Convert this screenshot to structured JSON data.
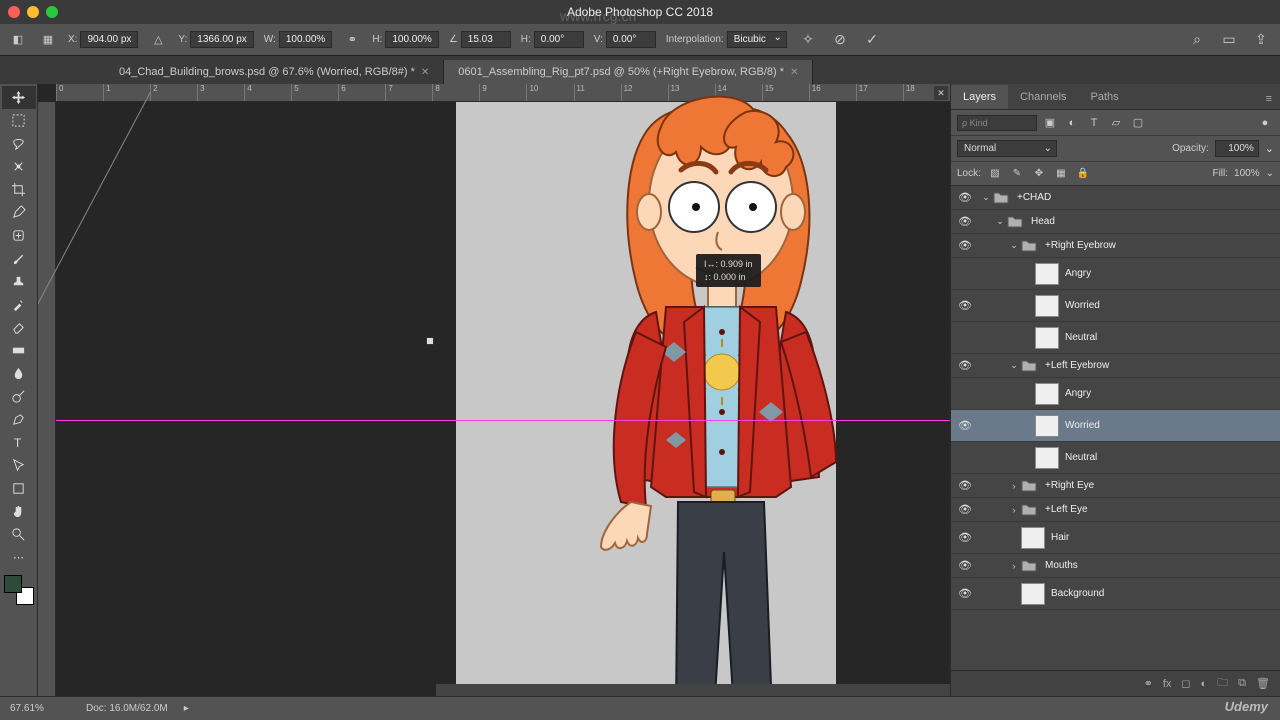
{
  "app": {
    "title": "Adobe Photoshop CC 2018"
  },
  "options": {
    "x_label": "X:",
    "x_value": "904.00 px",
    "y_label": "Y:",
    "y_value": "1366.00 px",
    "w_label": "W:",
    "w_value": "100.00%",
    "h_label": "H:",
    "h_value": "100.00%",
    "angle_label": "∠",
    "angle_value": "15.03",
    "hskew_label": "H:",
    "hskew_value": "0.00°",
    "vskew_label": "V:",
    "vskew_value": "0.00°",
    "interp_label": "Interpolation:",
    "interp_value": "Bicubic"
  },
  "tabs": [
    {
      "label": "04_Chad_Building_brows.psd @ 67.6% (Worried, RGB/8#) *",
      "active": false
    },
    {
      "label": "0601_Assembling_Rig_pt7.psd @ 50% (+Right Eyebrow, RGB/8) *",
      "active": true
    }
  ],
  "ruler_marks": [
    "0",
    "1",
    "2",
    "3",
    "4",
    "5",
    "6",
    "7",
    "8",
    "9",
    "10",
    "11",
    "12",
    "13",
    "14",
    "15",
    "16",
    "17",
    "18"
  ],
  "measure": {
    "line1": "I↔: 0.909 in",
    "line2": "↕: 0.000 in"
  },
  "panels": {
    "tabs": {
      "layers": "Layers",
      "channels": "Channels",
      "paths": "Paths"
    },
    "filter_placeholder": "ρ Kind",
    "blend_mode": "Normal",
    "opacity_label": "Opacity:",
    "opacity_value": "100%",
    "lock_label": "Lock:",
    "fill_label": "Fill:",
    "fill_value": "100%"
  },
  "layers": [
    {
      "name": "+CHAD",
      "type": "group",
      "indent": 0,
      "vis": true,
      "open": true
    },
    {
      "name": "Head",
      "type": "group",
      "indent": 1,
      "vis": true,
      "open": true
    },
    {
      "name": "+Right Eyebrow",
      "type": "group",
      "indent": 2,
      "vis": true,
      "open": true
    },
    {
      "name": "Angry",
      "type": "layer",
      "indent": 3,
      "vis": false
    },
    {
      "name": "Worried",
      "type": "layer",
      "indent": 3,
      "vis": true
    },
    {
      "name": "Neutral",
      "type": "layer",
      "indent": 3,
      "vis": false
    },
    {
      "name": "+Left Eyebrow",
      "type": "group",
      "indent": 2,
      "vis": true,
      "open": true
    },
    {
      "name": "Angry",
      "type": "layer",
      "indent": 3,
      "vis": false
    },
    {
      "name": "Worried",
      "type": "layer",
      "indent": 3,
      "vis": true,
      "selected": true
    },
    {
      "name": "Neutral",
      "type": "layer",
      "indent": 3,
      "vis": false
    },
    {
      "name": "+Right Eye",
      "type": "group",
      "indent": 2,
      "vis": true,
      "open": false
    },
    {
      "name": "+Left Eye",
      "type": "group",
      "indent": 2,
      "vis": true,
      "open": false
    },
    {
      "name": "Hair",
      "type": "layer",
      "indent": 2,
      "vis": true
    },
    {
      "name": "Mouths",
      "type": "group",
      "indent": 2,
      "vis": true,
      "open": false
    },
    {
      "name": "Background",
      "type": "layer",
      "indent": 2,
      "vis": true
    }
  ],
  "status": {
    "zoom": "67.61%",
    "doc": "Doc: 16.0M/62.0M"
  },
  "watermark_url": "www.rrcg.cn",
  "brand": "Udemy"
}
